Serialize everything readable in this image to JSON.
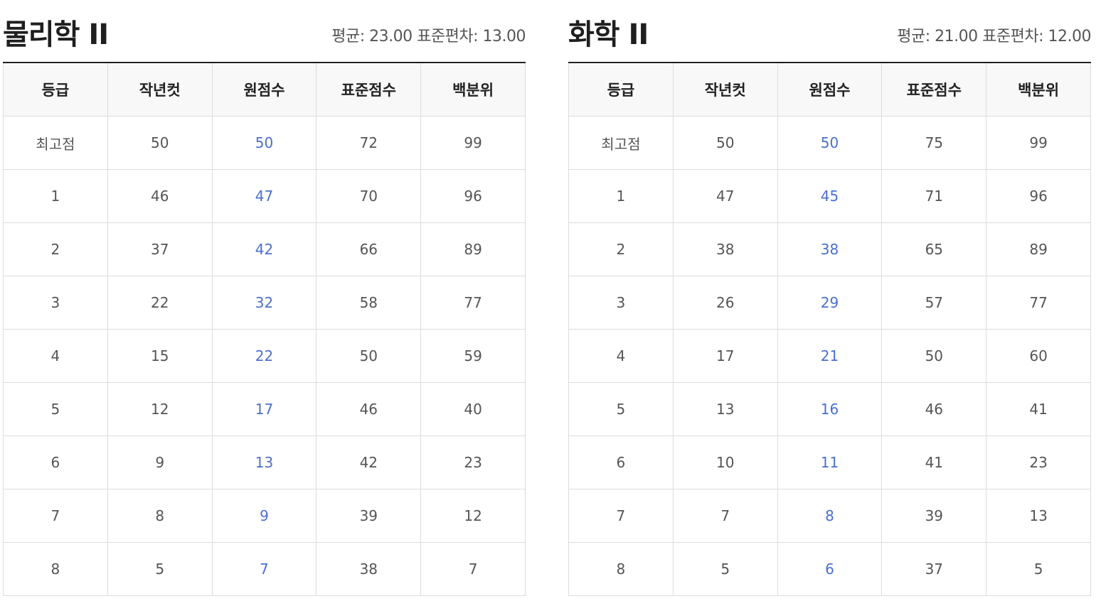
{
  "left": {
    "title": "물리학 II",
    "stats": "평균: 23.00 표준편차: 13.00",
    "columns": [
      "등급",
      "작년컷",
      "원점수",
      "표준점수",
      "백분위"
    ],
    "rows": [
      [
        "최고점",
        "50",
        "50",
        "72",
        "99"
      ],
      [
        "1",
        "46",
        "47",
        "70",
        "96"
      ],
      [
        "2",
        "37",
        "42",
        "66",
        "89"
      ],
      [
        "3",
        "22",
        "32",
        "58",
        "77"
      ],
      [
        "4",
        "15",
        "22",
        "50",
        "59"
      ],
      [
        "5",
        "12",
        "17",
        "46",
        "40"
      ],
      [
        "6",
        "9",
        "13",
        "42",
        "23"
      ],
      [
        "7",
        "8",
        "9",
        "39",
        "12"
      ],
      [
        "8",
        "5",
        "7",
        "38",
        "7"
      ]
    ]
  },
  "right": {
    "title": "화학 II",
    "stats": "평균: 21.00 표준편차: 12.00",
    "columns": [
      "등급",
      "작년컷",
      "원점수",
      "표준점수",
      "백분위"
    ],
    "rows": [
      [
        "최고점",
        "50",
        "50",
        "75",
        "99"
      ],
      [
        "1",
        "47",
        "45",
        "71",
        "96"
      ],
      [
        "2",
        "38",
        "38",
        "65",
        "89"
      ],
      [
        "3",
        "26",
        "29",
        "57",
        "77"
      ],
      [
        "4",
        "17",
        "21",
        "50",
        "60"
      ],
      [
        "5",
        "13",
        "16",
        "46",
        "41"
      ],
      [
        "6",
        "10",
        "11",
        "41",
        "23"
      ],
      [
        "7",
        "7",
        "8",
        "39",
        "13"
      ],
      [
        "8",
        "5",
        "6",
        "37",
        "5"
      ]
    ]
  },
  "colors": {
    "raw_score_text": "#4a6fd0",
    "header_bg": "#f8f8f8",
    "border": "#dcdcdc",
    "top_rule": "#222222"
  }
}
